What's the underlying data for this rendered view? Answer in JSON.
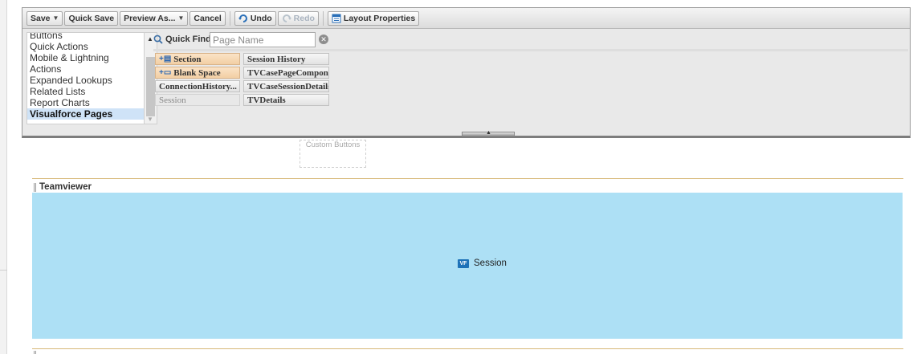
{
  "toolbar": {
    "save": "Save",
    "quick_save": "Quick Save",
    "preview_as": "Preview As...",
    "cancel": "Cancel",
    "undo": "Undo",
    "redo": "Redo",
    "layout_properties": "Layout Properties"
  },
  "categories": {
    "items": [
      "Buttons",
      "Quick Actions",
      "Mobile & Lightning Actions",
      "Expanded Lookups",
      "Related Lists",
      "Report Charts",
      "Visualforce Pages"
    ],
    "selected": "Visualforce Pages"
  },
  "quick_find": {
    "label": "Quick Find",
    "placeholder": "Page Name"
  },
  "palette_elements": [
    {
      "label": "Section",
      "kind": "layout"
    },
    {
      "label": "Session History",
      "kind": "plain"
    },
    {
      "label": "Blank Space",
      "kind": "layout"
    },
    {
      "label": "TVCasePageComponen",
      "kind": "plain"
    },
    {
      "label": "ConnectionHistory...",
      "kind": "plain"
    },
    {
      "label": "TVCaseSessionDetails",
      "kind": "plain"
    },
    {
      "label": "Session",
      "kind": "used"
    },
    {
      "label": "TVDetails",
      "kind": "plain"
    }
  ],
  "canvas": {
    "custom_buttons": "Custom Buttons",
    "section_title": "Teamviewer",
    "vf_badge": "VF",
    "vf_page_label": "Session"
  },
  "colors": {
    "vf_area": "#ade0f5",
    "section_rule": "#d7b877",
    "layout_element": "#f2cfa4",
    "selected_category": "#cfe3f7"
  }
}
